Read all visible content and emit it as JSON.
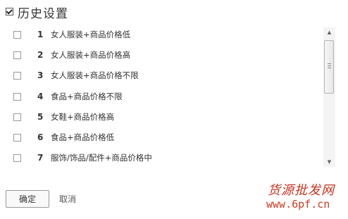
{
  "header": {
    "checked": true,
    "title": "历史设置"
  },
  "items": [
    {
      "num": "1",
      "label": "女人服装+商品价格低"
    },
    {
      "num": "2",
      "label": "女人服装+商品价格高"
    },
    {
      "num": "3",
      "label": "女人服装+商品价格不限"
    },
    {
      "num": "4",
      "label": "食品+商品价格不限"
    },
    {
      "num": "5",
      "label": "女鞋+商品价格高"
    },
    {
      "num": "6",
      "label": "食品+商品价格低"
    },
    {
      "num": "7",
      "label": "服饰/饰品/配件+商品价格中"
    }
  ],
  "buttons": {
    "ok_label": "确定",
    "cancel_label": "取消"
  },
  "watermark": {
    "chinese": "货源批发网",
    "url": "www.6pf.cn",
    "color": "#c8321f"
  },
  "icons": {
    "scroll_up": "scroll-up-arrow-icon",
    "scroll_down": "scroll-down-arrow-icon"
  }
}
